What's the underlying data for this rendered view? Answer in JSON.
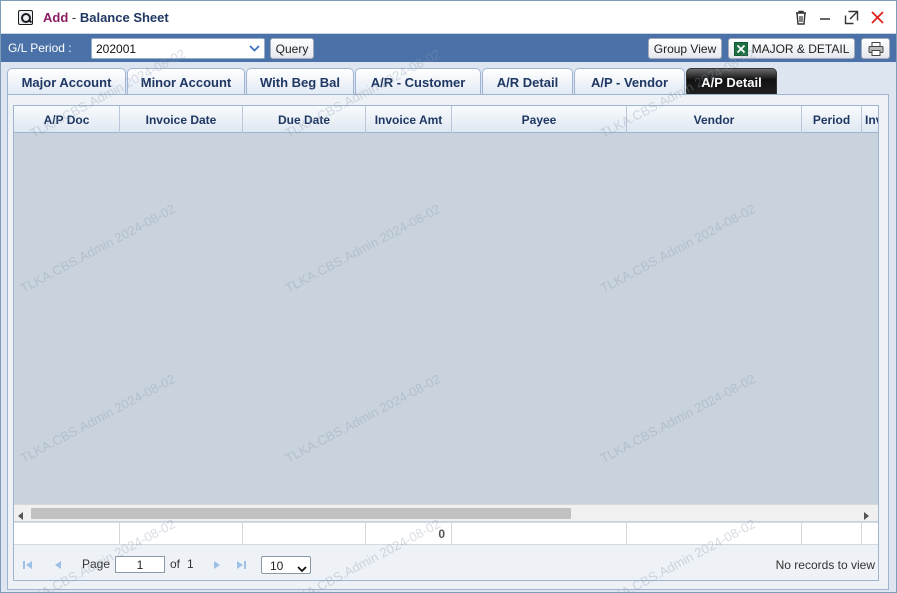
{
  "window": {
    "title_mode": "Add",
    "title_separator": " - ",
    "title_name": "Balance Sheet"
  },
  "icons": {
    "app": "search-window-icon",
    "delete": "trash-icon",
    "minimize": "minimize-icon",
    "maximize": "maximize-icon",
    "close": "close-icon",
    "excel": "excel-icon",
    "print": "printer-icon"
  },
  "colors": {
    "toolbar_bg": "#4a72a8",
    "close_red": "#e02020",
    "title_mode": "#8b1c62",
    "grid_bg": "#c9d3de",
    "active_tab": "#1a1a1a"
  },
  "toolbar": {
    "gl_period_label": "G/L Period :",
    "gl_period_value": "202001",
    "query_label": "Query",
    "group_view_label": "Group View",
    "major_detail_label": "MAJOR & DETAIL"
  },
  "tabs": [
    {
      "label": "Major Account",
      "active": false
    },
    {
      "label": "Minor Account",
      "active": false
    },
    {
      "label": "With Beg Bal",
      "active": false
    },
    {
      "label": "A/R - Customer",
      "active": false
    },
    {
      "label": "A/R Detail",
      "active": false
    },
    {
      "label": "A/P - Vendor",
      "active": false
    },
    {
      "label": "A/P Detail",
      "active": true
    }
  ],
  "grid": {
    "columns": [
      "A/P Doc",
      "Invoice Date",
      "Due Date",
      "Invoice Amt",
      "Payee",
      "Vendor",
      "Period",
      "Inv"
    ],
    "rows": [],
    "footer": {
      "invoice_amt_total": "0"
    }
  },
  "pager": {
    "page_label": "Page",
    "page_value": "1",
    "of_label": "of",
    "total_pages": "1",
    "page_size": "10",
    "status": "No records to view"
  },
  "watermark": "TLKA.CBS.Admin 2024-08-02"
}
